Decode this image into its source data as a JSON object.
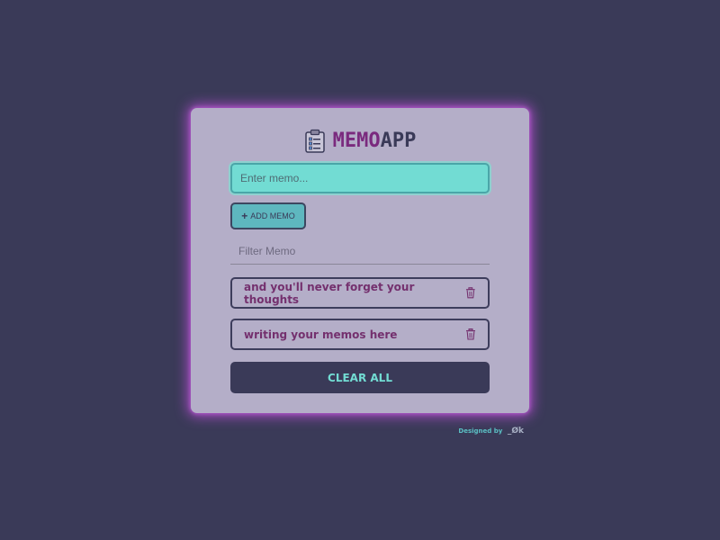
{
  "app": {
    "title_part1": "MEMO",
    "title_part2": "APP",
    "logo_icon": "clipboard-list-icon"
  },
  "form": {
    "memo_placeholder": "Enter memo...",
    "memo_value": "",
    "add_icon": "plus-icon",
    "add_label": "ADD MEMO"
  },
  "filter": {
    "placeholder": "Filter Memo",
    "value": ""
  },
  "memos": [
    {
      "text": "and you'll never forget your thoughts",
      "icon": "trash-icon"
    },
    {
      "text": "writing your memos here",
      "icon": "trash-icon"
    }
  ],
  "actions": {
    "clear_label": "CLEAR ALL"
  },
  "footer": {
    "designed_by": "Designed by",
    "author": "_Øk"
  },
  "colors": {
    "background": "#3a3a58",
    "card": "#b4aec8",
    "glow": "#c050dc",
    "accent_teal": "#72dcd3",
    "memo_text": "#74306e",
    "title_memo": "#7a2a7e"
  }
}
